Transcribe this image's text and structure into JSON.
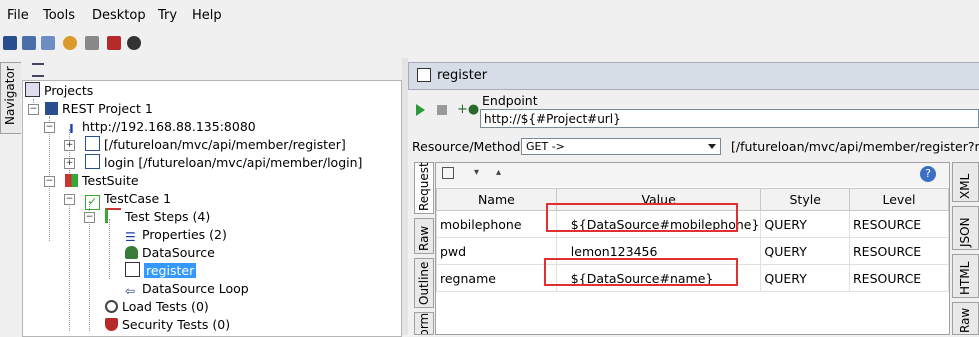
{
  "menu": [
    "File",
    "Tools",
    "Desktop",
    "Try",
    "Help"
  ],
  "navigator_label": "Navigator",
  "tree": {
    "projects": "Projects",
    "project": "REST Project 1",
    "service": "http://192.168.88.135:8080",
    "resources": [
      "[/futureloan/mvc/api/member/register]",
      "login [/futureloan/mvc/api/member/login]"
    ],
    "suite": "TestSuite",
    "testcase": "TestCase 1",
    "steps": "Test Steps (4)",
    "step_items": [
      "Properties (2)",
      "DataSource",
      "register",
      "DataSource Loop"
    ],
    "load": "Load Tests (0)",
    "security": "Security Tests (0)"
  },
  "editor": {
    "title": "register",
    "endpoint_label": "Endpoint",
    "endpoint_value": "http://${#Project#url}",
    "resource_label": "Resource/Method:",
    "method_value": "GET ->",
    "path": "[/futureloan/mvc/api/member/register?mo",
    "left_tabs": [
      "Request",
      "Raw",
      "Outline",
      "Form"
    ],
    "right_tabs": [
      "XML",
      "JSON",
      "HTML",
      "Raw"
    ],
    "columns": [
      "Name",
      "Value",
      "Style",
      "Level"
    ],
    "rows": [
      {
        "name": "mobilephone",
        "value": "${DataSource#mobilephone}",
        "style": "QUERY",
        "level": "RESOURCE"
      },
      {
        "name": "pwd",
        "value": "lemon123456",
        "style": "QUERY",
        "level": "RESOURCE"
      },
      {
        "name": "regname",
        "value": "${DataSource#name}",
        "style": "QUERY",
        "level": "RESOURCE"
      }
    ]
  },
  "colors": {
    "highlight": "#e03030",
    "selection": "#3399ff"
  }
}
